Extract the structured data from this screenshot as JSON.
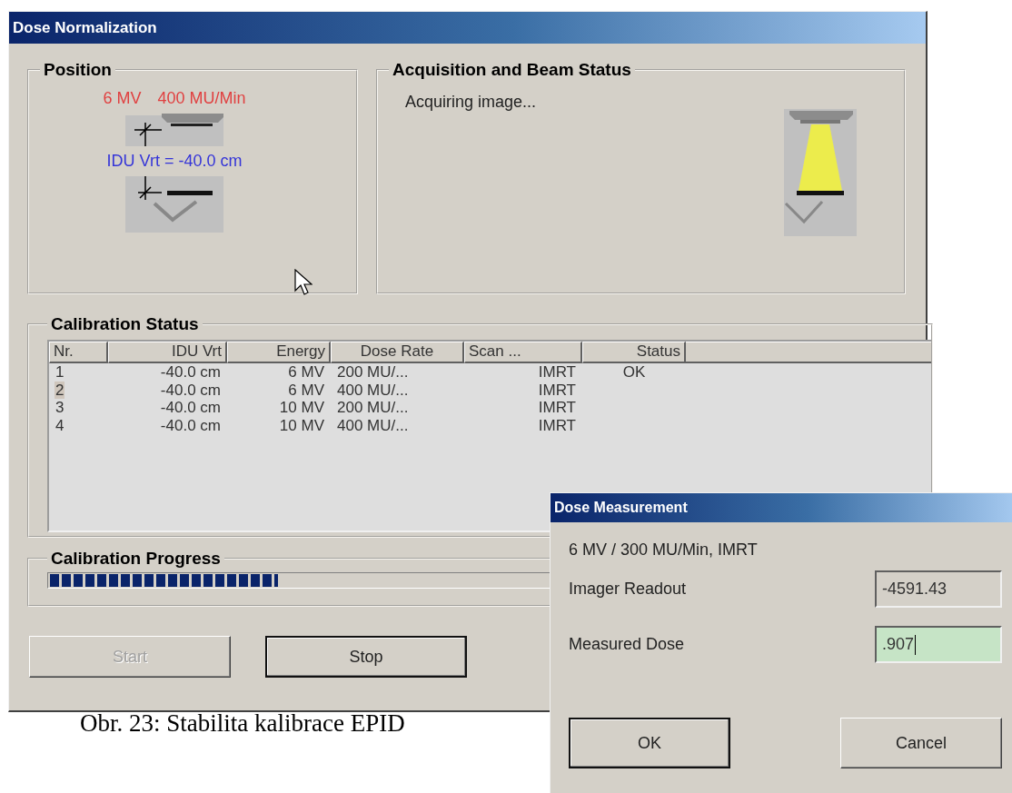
{
  "window": {
    "title": "Dose Normalization"
  },
  "position": {
    "title": "Position",
    "energy": "6 MV",
    "dose_rate": "400 MU/Min",
    "idu_position": "IDU Vrt = -40.0 cm"
  },
  "acquisition": {
    "title": "Acquisition and Beam Status",
    "message": "Acquiring image...",
    "beam_on": true
  },
  "calibration_status": {
    "title": "Calibration Status",
    "columns": [
      "Nr.",
      "IDU Vrt",
      "Energy",
      "Dose Rate",
      "Scan ...",
      "Status"
    ],
    "rows": [
      {
        "cells": [
          "1",
          "-40.0 cm",
          "6 MV",
          "200 MU/...",
          "IMRT",
          "OK"
        ],
        "selected": false
      },
      {
        "cells": [
          "2",
          "-40.0 cm",
          "6 MV",
          "400 MU/...",
          "IMRT",
          ""
        ],
        "selected": true
      },
      {
        "cells": [
          "3",
          "-40.0 cm",
          "10 MV",
          "200 MU/...",
          "IMRT",
          ""
        ],
        "selected": false
      },
      {
        "cells": [
          "4",
          "-40.0 cm",
          "10 MV",
          "400 MU/...",
          "IMRT",
          ""
        ],
        "selected": false
      }
    ]
  },
  "calibration_progress": {
    "title": "Calibration Progress",
    "level": 0.26
  },
  "buttons": [
    {
      "label": "Start",
      "disabled": true,
      "default": false
    },
    {
      "label": "Stop",
      "disabled": false,
      "default": true
    }
  ],
  "caption": "Obr. 23: Stabilita kalibrace EPID",
  "dialog": {
    "title": "Dose Measurement",
    "setting": "6 MV / 300 MU/Min, IMRT",
    "fields": [
      {
        "label": "Imager Readout",
        "value": "-4591.43",
        "focused": false
      },
      {
        "label": "Measured Dose",
        "value": ".907",
        "focused": true
      }
    ],
    "buttons": [
      {
        "label": "OK",
        "default": true
      },
      {
        "label": "Cancel",
        "default": false
      }
    ]
  }
}
